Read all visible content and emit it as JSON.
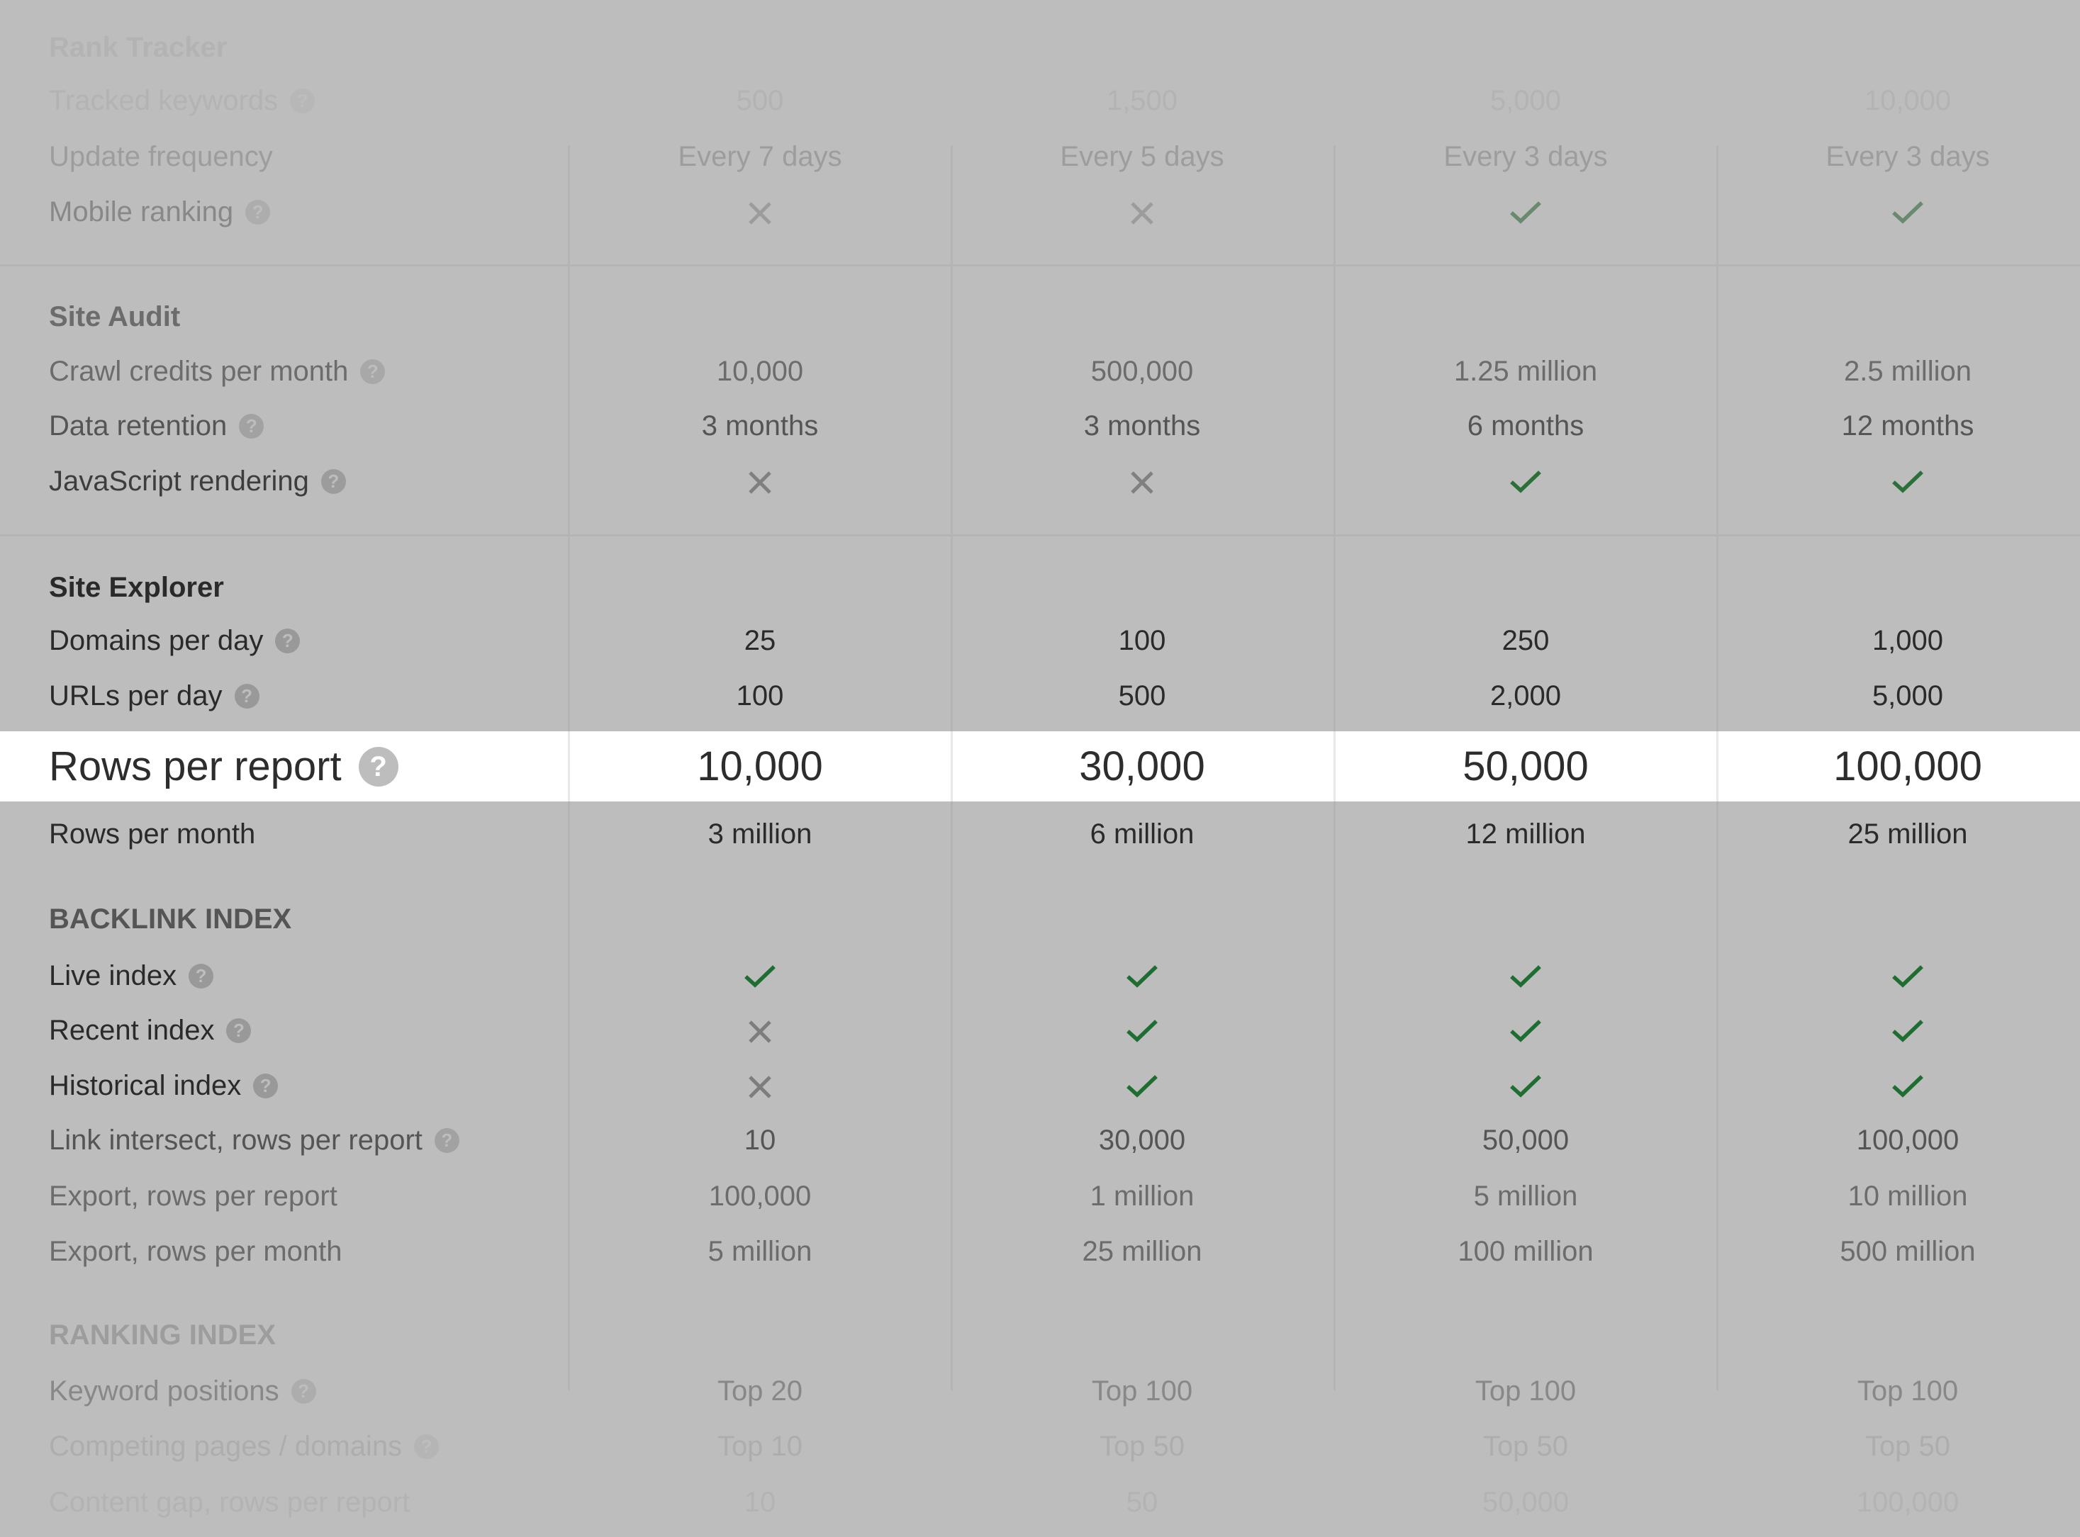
{
  "colors": {
    "overlay_bg": "#bdbdbd",
    "highlight_bg": "#ffffff",
    "check_green": "#1e6e32",
    "cross_gray": "#888888"
  },
  "plans_count": 4,
  "sections": {
    "rank_tracker": {
      "title": "Rank Tracker",
      "rows": [
        {
          "label": "Tracked keywords",
          "help": true,
          "values": [
            "500",
            "1,500",
            "5,000",
            "10,000"
          ]
        },
        {
          "label": "Update frequency",
          "help": false,
          "values": [
            "Every 7 days",
            "Every 5 days",
            "Every 3 days",
            "Every 3 days"
          ]
        },
        {
          "label": "Mobile ranking",
          "help": true,
          "values": [
            "cross",
            "cross",
            "check",
            "check"
          ]
        }
      ]
    },
    "site_audit": {
      "title": "Site Audit",
      "rows": [
        {
          "label": "Crawl credits per month",
          "help": true,
          "values": [
            "10,000",
            "500,000",
            "1.25 million",
            "2.5 million"
          ]
        },
        {
          "label": "Data retention",
          "help": true,
          "values": [
            "3 months",
            "3 months",
            "6 months",
            "12 months"
          ]
        },
        {
          "label": "JavaScript rendering",
          "help": true,
          "values": [
            "cross",
            "cross",
            "check",
            "check"
          ]
        }
      ]
    },
    "site_explorer": {
      "title": "Site Explorer",
      "rows": [
        {
          "label": "Domains per day",
          "help": true,
          "values": [
            "25",
            "100",
            "250",
            "1,000"
          ]
        },
        {
          "label": "URLs per day",
          "help": true,
          "values": [
            "100",
            "500",
            "2,000",
            "5,000"
          ]
        },
        {
          "label": "Rows per report",
          "help": true,
          "highlighted": true,
          "values": [
            "10,000",
            "30,000",
            "50,000",
            "100,000"
          ]
        },
        {
          "label": "Rows per month",
          "help": false,
          "values": [
            "3 million",
            "6 million",
            "12 million",
            "25 million"
          ]
        }
      ]
    },
    "backlink_index": {
      "title": "BACKLINK INDEX",
      "rows": [
        {
          "label": "Live index",
          "help": true,
          "values": [
            "check",
            "check",
            "check",
            "check"
          ]
        },
        {
          "label": "Recent index",
          "help": true,
          "values": [
            "cross",
            "check",
            "check",
            "check"
          ]
        },
        {
          "label": "Historical index",
          "help": true,
          "values": [
            "cross",
            "check",
            "check",
            "check"
          ]
        },
        {
          "label": "Link intersect, rows per report",
          "help": true,
          "values": [
            "10",
            "30,000",
            "50,000",
            "100,000"
          ]
        },
        {
          "label": "Export, rows per report",
          "help": false,
          "values": [
            "100,000",
            "1 million",
            "5 million",
            "10 million"
          ]
        },
        {
          "label": "Export, rows per month",
          "help": false,
          "values": [
            "5 million",
            "25 million",
            "100 million",
            "500 million"
          ]
        }
      ]
    },
    "ranking_index": {
      "title": "RANKING INDEX",
      "rows": [
        {
          "label": "Keyword positions",
          "help": true,
          "values": [
            "Top 20",
            "Top 100",
            "Top 100",
            "Top 100"
          ]
        },
        {
          "label": "Competing pages / domains",
          "help": true,
          "values": [
            "Top 10",
            "Top 50",
            "Top 50",
            "Top 50"
          ]
        },
        {
          "label": "Content gap, rows per report",
          "help": false,
          "values": [
            "10",
            "50",
            "50,000",
            "100,000"
          ]
        }
      ]
    }
  },
  "help_glyph": "?"
}
